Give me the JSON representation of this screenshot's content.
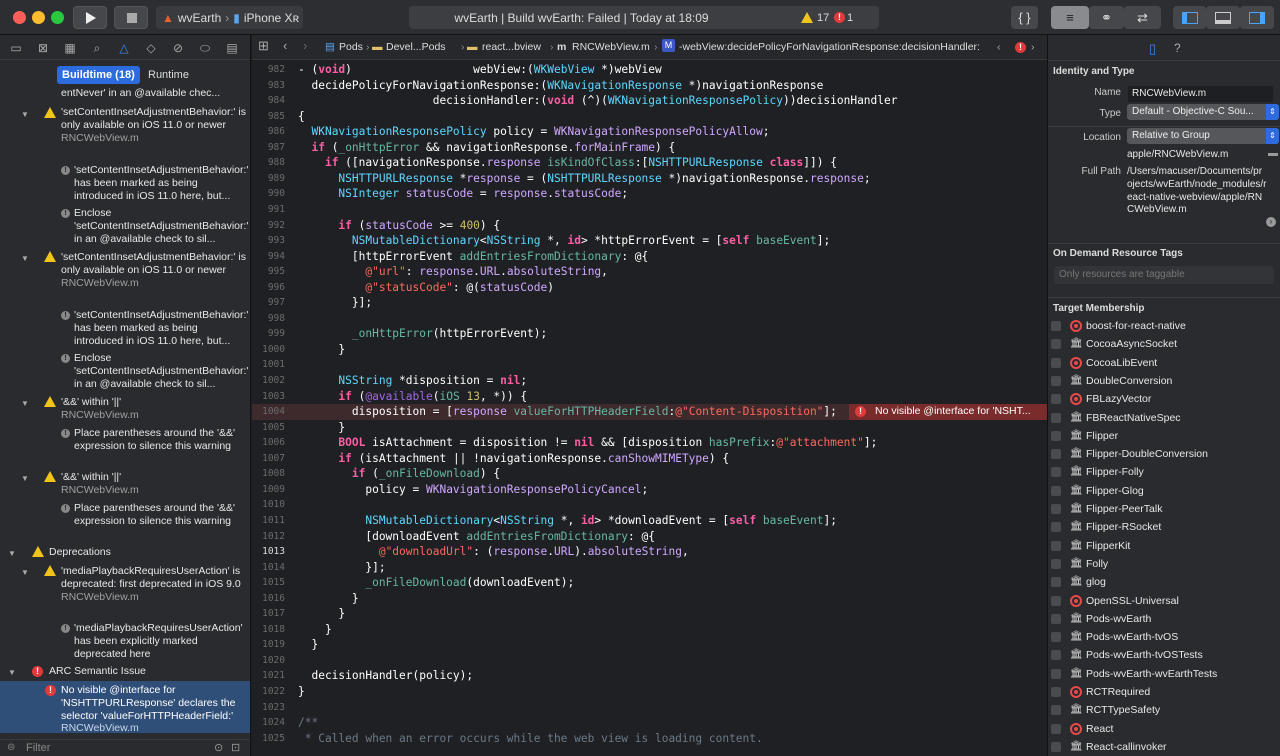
{
  "toolbar": {
    "scheme_project": "wvEarth",
    "scheme_device": "iPhone Xʀ",
    "status_text": "wvEarth | Build wvEarth: Failed | Today at 18:09",
    "warning_count": "17",
    "error_count": "1",
    "braces_label": "{ }"
  },
  "navigator": {
    "tabs": {
      "buildtime": "Buildtime (18)",
      "runtime": "Runtime"
    },
    "filter_placeholder": "Filter",
    "issues": [
      {
        "text": "entNever' in an @available chec...",
        "kind": "cont"
      },
      {
        "text": "'setContentInsetAdjustmentBehavior:' is only available on iOS 11.0 or newer",
        "file": "RNCWebView.m",
        "kind": "warning"
      },
      {
        "text": "'setContentInsetAdjustmentBehavior:' has been marked as being introduced in iOS 11.0 here, but...",
        "kind": "note"
      },
      {
        "text": "Enclose 'setContentInsetAdjustmentBehavior:' in an @available check to sil...",
        "kind": "note"
      },
      {
        "text": "'setContentInsetAdjustmentBehavior:' is only available on iOS 11.0 or newer",
        "file": "RNCWebView.m",
        "kind": "warning"
      },
      {
        "text": "'setContentInsetAdjustmentBehavior:' has been marked as being introduced in iOS 11.0 here, but...",
        "kind": "note"
      },
      {
        "text": "Enclose 'setContentInsetAdjustmentBehavior:' in an @available check to sil...",
        "kind": "note"
      },
      {
        "text": "'&&' within '||'",
        "file": "RNCWebView.m",
        "kind": "warning"
      },
      {
        "text": "Place parentheses around the '&&' expression to silence this warning",
        "kind": "note"
      },
      {
        "text": "'&&' within '||'",
        "file": "RNCWebView.m",
        "kind": "warning"
      },
      {
        "text": "Place parentheses around the '&&' expression to silence this warning",
        "kind": "note"
      },
      {
        "text": "Deprecations",
        "kind": "group-warning"
      },
      {
        "text": "'mediaPlaybackRequiresUserAction' is deprecated: first deprecated in iOS 9.0",
        "file": "RNCWebView.m",
        "kind": "warning"
      },
      {
        "text": "'mediaPlaybackRequiresUserAction' has been explicitly marked deprecated here",
        "kind": "note"
      },
      {
        "text": "ARC Semantic Issue",
        "kind": "group-error"
      },
      {
        "text": "No visible @interface for 'NSHTTPURLResponse' declares the selector 'valueForHTTPHeaderField:'",
        "file": "RNCWebView.m",
        "kind": "error"
      }
    ]
  },
  "jumpbar": {
    "crumbs": [
      "Pods",
      "Devel...Pods",
      "react...bview",
      "RNCWebView.m",
      "-webView:decidePolicyForNavigationResponse:decisionHandler:"
    ]
  },
  "editor": {
    "error_message": "No visible @interface for 'NSHT...",
    "lines": [
      {
        "n": "982",
        "t": "- (void)                  webView:(WKWebView *)webView"
      },
      {
        "n": "983",
        "t": "  decidePolicyForNavigationResponse:(WKNavigationResponse *)navigationResponse"
      },
      {
        "n": "984",
        "t": "                    decisionHandler:(void (^)(WKNavigationResponsePolicy))decisionHandler"
      },
      {
        "n": "985",
        "t": "{"
      },
      {
        "n": "986",
        "t": "  WKNavigationResponsePolicy policy = WKNavigationResponsePolicyAllow;"
      },
      {
        "n": "987",
        "t": "  if (_onHttpError && navigationResponse.forMainFrame) {"
      },
      {
        "n": "988",
        "t": "    if ([navigationResponse.response isKindOfClass:[NSHTTPURLResponse class]]) {"
      },
      {
        "n": "989",
        "t": "      NSHTTPURLResponse *response = (NSHTTPURLResponse *)navigationResponse.response;"
      },
      {
        "n": "990",
        "t": "      NSInteger statusCode = response.statusCode;"
      },
      {
        "n": "991",
        "t": ""
      },
      {
        "n": "992",
        "t": "      if (statusCode >= 400) {"
      },
      {
        "n": "993",
        "t": "        NSMutableDictionary<NSString *, id> *httpErrorEvent = [self baseEvent];"
      },
      {
        "n": "994",
        "t": "        [httpErrorEvent addEntriesFromDictionary: @{"
      },
      {
        "n": "995",
        "t": "          @\"url\": response.URL.absoluteString,"
      },
      {
        "n": "996",
        "t": "          @\"statusCode\": @(statusCode)"
      },
      {
        "n": "997",
        "t": "        }];"
      },
      {
        "n": "998",
        "t": ""
      },
      {
        "n": "999",
        "t": "        _onHttpError(httpErrorEvent);"
      },
      {
        "n": "1000",
        "t": "      }"
      },
      {
        "n": "1001",
        "t": ""
      },
      {
        "n": "1002",
        "t": "      NSString *disposition = nil;"
      },
      {
        "n": "1003",
        "t": "      if (@available(iOS 13, *)) {"
      },
      {
        "n": "1004",
        "t": "        disposition = [response valueForHTTPHeaderField:@\"Content-Disposition\"];"
      },
      {
        "n": "1005",
        "t": "      }"
      },
      {
        "n": "1006",
        "t": "      BOOL isAttachment = disposition != nil && [disposition hasPrefix:@\"attachment\"];"
      },
      {
        "n": "1007",
        "t": "      if (isAttachment || !navigationResponse.canShowMIMEType) {"
      },
      {
        "n": "1008",
        "t": "        if (_onFileDownload) {"
      },
      {
        "n": "1009",
        "t": "          policy = WKNavigationResponsePolicyCancel;"
      },
      {
        "n": "1010",
        "t": ""
      },
      {
        "n": "1011",
        "t": "          NSMutableDictionary<NSString *, id> *downloadEvent = [self baseEvent];"
      },
      {
        "n": "1012",
        "t": "          [downloadEvent addEntriesFromDictionary: @{"
      },
      {
        "n": "1013",
        "t": "            @\"downloadUrl\": (response.URL).absoluteString,"
      },
      {
        "n": "1014",
        "t": "          }];"
      },
      {
        "n": "1015",
        "t": "          _onFileDownload(downloadEvent);"
      },
      {
        "n": "1016",
        "t": "        }"
      },
      {
        "n": "1017",
        "t": "      }"
      },
      {
        "n": "1018",
        "t": "    }"
      },
      {
        "n": "1019",
        "t": "  }"
      },
      {
        "n": "1020",
        "t": ""
      },
      {
        "n": "1021",
        "t": "  decisionHandler(policy);"
      },
      {
        "n": "1022",
        "t": "}"
      },
      {
        "n": "1023",
        "t": ""
      },
      {
        "n": "1024",
        "t": "/**"
      },
      {
        "n": "1025",
        "t": " * Called when an error occurs while the web view is loading content."
      }
    ]
  },
  "inspector": {
    "identity_title": "Identity and Type",
    "name_label": "Name",
    "name_value": "RNCWebView.m",
    "type_label": "Type",
    "type_value": "Default - Objective-C Sou...",
    "location_label": "Location",
    "location_value": "Relative to Group",
    "location_path": "apple/RNCWebView.m",
    "fullpath_label": "Full Path",
    "fullpath_value": "/Users/macuser/Documents/projects/wvEarth/node_modules/react-native-webview/apple/RNCWebView.m",
    "odr_title": "On Demand Resource Tags",
    "odr_placeholder": "Only resources are taggable",
    "membership_title": "Target Membership",
    "targets": [
      {
        "name": "boost-for-react-native",
        "icon": "target"
      },
      {
        "name": "CocoaAsyncSocket",
        "icon": "library"
      },
      {
        "name": "CocoaLibEvent",
        "icon": "target"
      },
      {
        "name": "DoubleConversion",
        "icon": "library"
      },
      {
        "name": "FBLazyVector",
        "icon": "target"
      },
      {
        "name": "FBReactNativeSpec",
        "icon": "library"
      },
      {
        "name": "Flipper",
        "icon": "library"
      },
      {
        "name": "Flipper-DoubleConversion",
        "icon": "library"
      },
      {
        "name": "Flipper-Folly",
        "icon": "library"
      },
      {
        "name": "Flipper-Glog",
        "icon": "library"
      },
      {
        "name": "Flipper-PeerTalk",
        "icon": "library"
      },
      {
        "name": "Flipper-RSocket",
        "icon": "library"
      },
      {
        "name": "FlipperKit",
        "icon": "library"
      },
      {
        "name": "Folly",
        "icon": "library"
      },
      {
        "name": "glog",
        "icon": "library"
      },
      {
        "name": "OpenSSL-Universal",
        "icon": "target"
      },
      {
        "name": "Pods-wvEarth",
        "icon": "library"
      },
      {
        "name": "Pods-wvEarth-tvOS",
        "icon": "library"
      },
      {
        "name": "Pods-wvEarth-tvOSTests",
        "icon": "library"
      },
      {
        "name": "Pods-wvEarth-wvEarthTests",
        "icon": "library"
      },
      {
        "name": "RCTRequired",
        "icon": "target"
      },
      {
        "name": "RCTTypeSafety",
        "icon": "library"
      },
      {
        "name": "React",
        "icon": "target"
      },
      {
        "name": "React-callinvoker",
        "icon": "library"
      }
    ]
  }
}
